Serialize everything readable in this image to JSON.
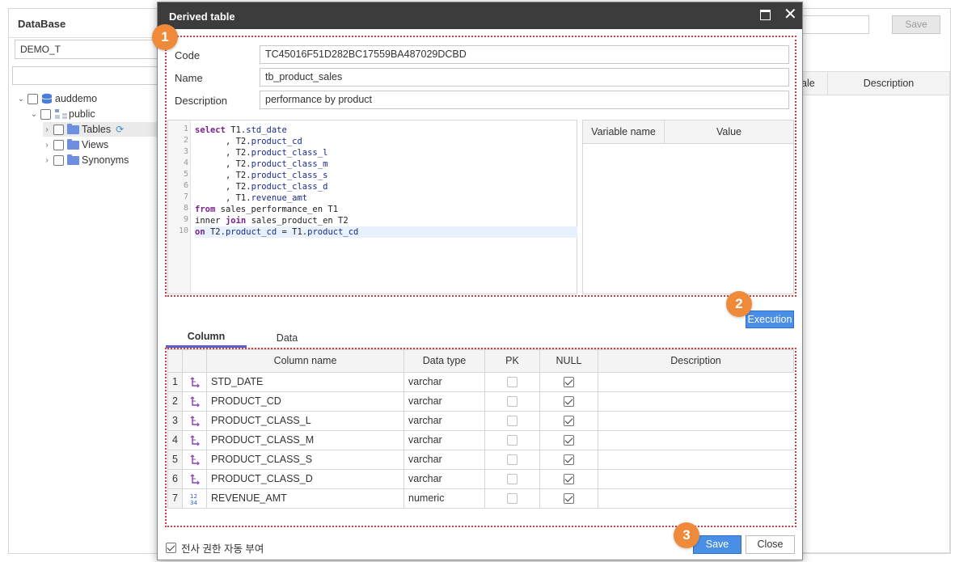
{
  "background": {
    "db_panel": {
      "title": "DataBase",
      "selected_db": "DEMO_T",
      "search_value": "",
      "tree": [
        {
          "label": "auddemo",
          "level": 0,
          "type": "db",
          "expanded": true
        },
        {
          "label": "public",
          "level": 1,
          "type": "schema",
          "expanded": true
        },
        {
          "label": "Tables",
          "level": 2,
          "type": "folder",
          "expanded": false,
          "selected": true
        },
        {
          "label": "Views",
          "level": 2,
          "type": "folder",
          "expanded": false
        },
        {
          "label": "Synonyms",
          "level": 2,
          "type": "folder",
          "expanded": false
        }
      ]
    },
    "right_panel": {
      "save_label": "Save",
      "grid_headers": [
        "ale",
        "Description"
      ]
    }
  },
  "dialog": {
    "title": "Derived table",
    "fields": {
      "code_label": "Code",
      "code_value": "TC45016F51D282BC17559BA487029DCBD",
      "name_label": "Name",
      "name_value": "tb_product_sales",
      "description_label": "Description",
      "description_value": "performance by product"
    },
    "sql_lines": [
      "select T1.std_date",
      "      , T2.product_cd",
      "      , T2.product_class_l",
      "      , T2.product_class_m",
      "      , T2.product_class_s",
      "      , T2.product_class_d",
      "      , T1.revenue_amt",
      "from sales_performance_en T1",
      "inner join sales_product_en T2",
      "on T2.product_cd = T1.product_cd"
    ],
    "line_numbers": [
      "1",
      "2",
      "3",
      "4",
      "5",
      "6",
      "7",
      "8",
      "9",
      "10"
    ],
    "variable_grid": {
      "headers": [
        "Variable name",
        "Value"
      ]
    },
    "execution_label": "Execution",
    "tabs": [
      "Column",
      "Data"
    ],
    "active_tab": "Column",
    "column_grid": {
      "headers": [
        "Column name",
        "Data type",
        "PK",
        "NULL",
        "Description"
      ],
      "rows": [
        {
          "no": "1",
          "type_icon": "string-type-icon",
          "name": "STD_DATE",
          "data_type": "varchar",
          "pk": false,
          "null": true,
          "description": ""
        },
        {
          "no": "2",
          "type_icon": "string-type-icon",
          "name": "PRODUCT_CD",
          "data_type": "varchar",
          "pk": false,
          "null": true,
          "description": ""
        },
        {
          "no": "3",
          "type_icon": "string-type-icon",
          "name": "PRODUCT_CLASS_L",
          "data_type": "varchar",
          "pk": false,
          "null": true,
          "description": ""
        },
        {
          "no": "4",
          "type_icon": "string-type-icon",
          "name": "PRODUCT_CLASS_M",
          "data_type": "varchar",
          "pk": false,
          "null": true,
          "description": ""
        },
        {
          "no": "5",
          "type_icon": "string-type-icon",
          "name": "PRODUCT_CLASS_S",
          "data_type": "varchar",
          "pk": false,
          "null": true,
          "description": ""
        },
        {
          "no": "6",
          "type_icon": "string-type-icon",
          "name": "PRODUCT_CLASS_D",
          "data_type": "varchar",
          "pk": false,
          "null": true,
          "description": ""
        },
        {
          "no": "7",
          "type_icon": "numeric-type-icon",
          "name": "REVENUE_AMT",
          "data_type": "numeric",
          "pk": false,
          "null": true,
          "description": ""
        }
      ]
    },
    "auto_grant_label": "전사 권한 자동 부여",
    "auto_grant_checked": true,
    "save_label": "Save",
    "close_label": "Close",
    "badges": [
      "1",
      "2",
      "3"
    ]
  },
  "colors": {
    "title_bar": "#3c3c3c",
    "primary_button": "#4a8fe6",
    "highlight_border": "#d23b3b",
    "badge": "#ee8a3a",
    "tab_underline": "#5b5bd6",
    "keyword": "#7a1f8f",
    "identifier": "#1a2a8a"
  }
}
